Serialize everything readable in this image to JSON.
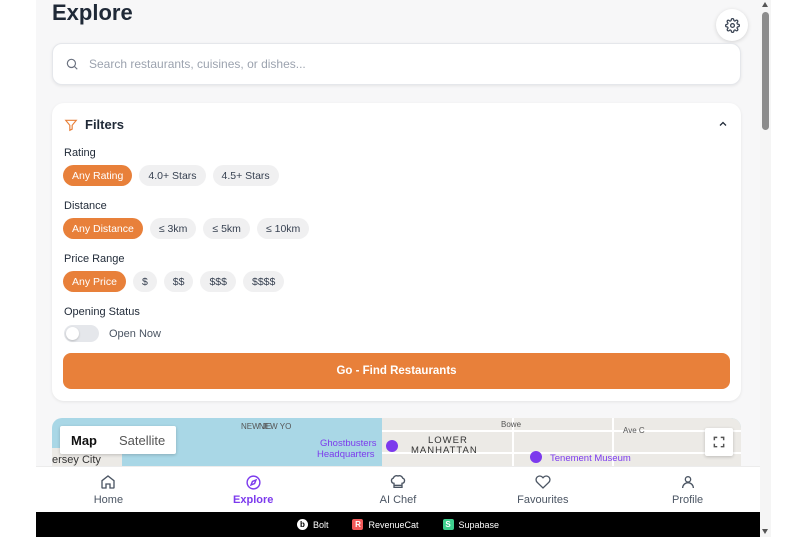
{
  "page": {
    "title": "Explore"
  },
  "search": {
    "placeholder": "Search restaurants, cuisines, or dishes..."
  },
  "filters": {
    "title": "Filters",
    "rating": {
      "label": "Rating",
      "options": [
        "Any Rating",
        "4.0+ Stars",
        "4.5+ Stars"
      ],
      "selected": 0
    },
    "distance": {
      "label": "Distance",
      "options": [
        "Any Distance",
        "≤ 3km",
        "≤ 5km",
        "≤ 10km"
      ],
      "selected": 0
    },
    "price": {
      "label": "Price Range",
      "options": [
        "Any Price",
        "$",
        "$$",
        "$$$",
        "$$$$"
      ],
      "selected": 0
    },
    "opening": {
      "label": "Opening Status",
      "toggle_label": "Open Now",
      "on": false
    },
    "go_button": "Go - Find Restaurants"
  },
  "map": {
    "modes": [
      "Map",
      "Satellite"
    ],
    "selected_mode": "Map",
    "labels": [
      "Ghostbusters",
      "Headquarters",
      "LOWER",
      "MANHATTAN",
      "Tenement Museum",
      "ersey City",
      "NEW JE",
      "NEW YO",
      "Bowe",
      "Ave C"
    ]
  },
  "nav": {
    "items": [
      {
        "label": "Home",
        "icon": "home-icon"
      },
      {
        "label": "Explore",
        "icon": "compass-icon",
        "active": true
      },
      {
        "label": "AI Chef",
        "icon": "chef-hat-icon"
      },
      {
        "label": "Favourites",
        "icon": "heart-icon"
      },
      {
        "label": "Profile",
        "icon": "user-icon"
      }
    ]
  },
  "footer": {
    "badges": [
      "Bolt",
      "RevenueCat",
      "Supabase"
    ]
  },
  "colors": {
    "accent": "#e8803a",
    "active_nav": "#7c3aed"
  }
}
